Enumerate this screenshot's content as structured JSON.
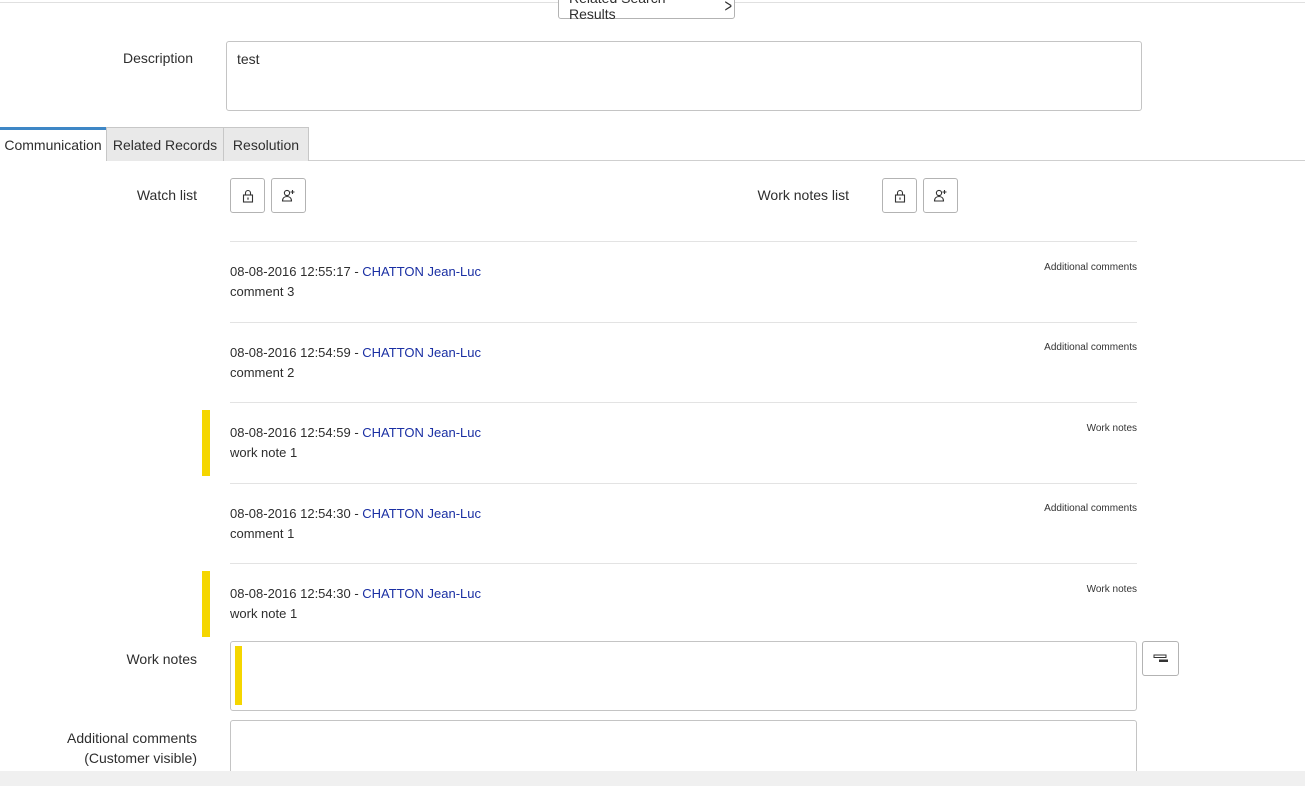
{
  "header": {
    "related_search_label": "Related Search Results"
  },
  "description": {
    "label": "Description",
    "value": "test"
  },
  "tabs": [
    {
      "label": "Communication",
      "active": true
    },
    {
      "label": "Related Records",
      "active": false
    },
    {
      "label": "Resolution",
      "active": false
    }
  ],
  "watch_list": {
    "label": "Watch list"
  },
  "work_notes_list": {
    "label": "Work notes list"
  },
  "entries": [
    {
      "timestamp": "08-08-2016 12:55:17",
      "separator": " - ",
      "author": "CHATTON Jean-Luc",
      "body": "comment 3",
      "type": "Additional comments"
    },
    {
      "timestamp": "08-08-2016 12:54:59",
      "separator": " - ",
      "author": "CHATTON Jean-Luc",
      "body": "comment 2",
      "type": "Additional comments"
    },
    {
      "timestamp": "08-08-2016 12:54:59",
      "separator": " - ",
      "author": "CHATTON Jean-Luc",
      "body": "work note 1",
      "type": "Work notes"
    },
    {
      "timestamp": "08-08-2016 12:54:30",
      "separator": " - ",
      "author": "CHATTON Jean-Luc",
      "body": "comment 1",
      "type": "Additional comments"
    },
    {
      "timestamp": "08-08-2016 12:54:30",
      "separator": " - ",
      "author": "CHATTON Jean-Luc",
      "body": "work note 1",
      "type": "Work notes"
    }
  ],
  "work_notes": {
    "label": "Work notes",
    "value": ""
  },
  "additional_comments": {
    "label_line1": "Additional comments",
    "label_line2": "(Customer visible)",
    "value": ""
  },
  "colors": {
    "tab_accent": "#3e87c6",
    "work_note_bar": "#f5d600",
    "author_link": "#1a2fa3"
  }
}
